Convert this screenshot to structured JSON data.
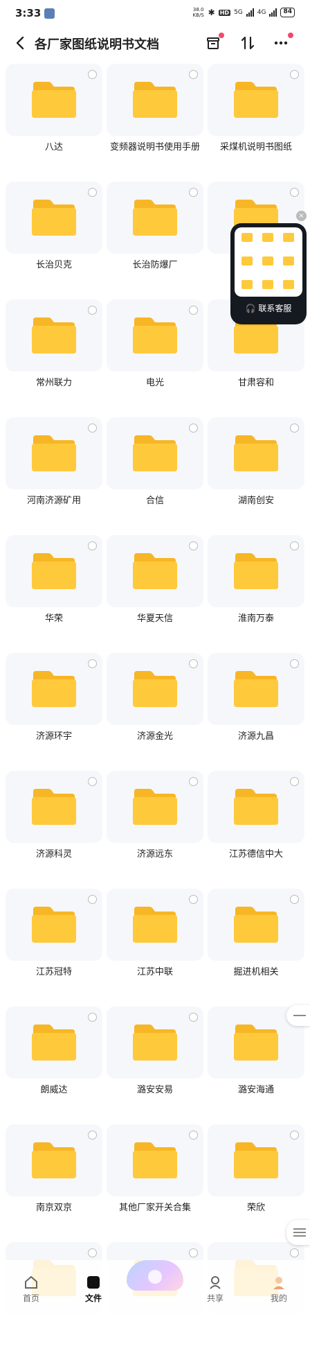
{
  "status_bar": {
    "time": "3:33",
    "net_speed_value": "38.0",
    "net_speed_unit": "KB/S",
    "hd": "HD",
    "network_5g": "5G",
    "network_4g": "4G",
    "battery": "84"
  },
  "header": {
    "title": "各厂家图纸说明书文档"
  },
  "folders": [
    {
      "label": "八达"
    },
    {
      "label": "变频器说明书使用手册"
    },
    {
      "label": "采煤机说明书图纸"
    },
    {
      "label": "长治贝克"
    },
    {
      "label": "长治防爆厂"
    },
    {
      "label": ""
    },
    {
      "label": "常州联力"
    },
    {
      "label": "电光"
    },
    {
      "label": "甘肃容和"
    },
    {
      "label": "河南济源矿用"
    },
    {
      "label": "合信"
    },
    {
      "label": "湖南创安"
    },
    {
      "label": "华荣"
    },
    {
      "label": "华夏天信"
    },
    {
      "label": "淮南万泰"
    },
    {
      "label": "济源环宇"
    },
    {
      "label": "济源金光"
    },
    {
      "label": "济源九昌"
    },
    {
      "label": "济源科灵"
    },
    {
      "label": "济源远东"
    },
    {
      "label": "江苏德信中大"
    },
    {
      "label": "江苏冠特"
    },
    {
      "label": "江苏中联"
    },
    {
      "label": "掘进机相关"
    },
    {
      "label": "朗威达"
    },
    {
      "label": "潞安安易"
    },
    {
      "label": "潞安海通"
    },
    {
      "label": "南京双京"
    },
    {
      "label": "其他厂家开关合集"
    },
    {
      "label": "荣欣"
    },
    {
      "label": ""
    },
    {
      "label": ""
    },
    {
      "label": ""
    }
  ],
  "floating_service": {
    "label": "联系客服"
  },
  "tabbar": {
    "items": [
      {
        "label": "首页"
      },
      {
        "label": "文件"
      },
      {
        "label": ""
      },
      {
        "label": "共享"
      },
      {
        "label": "我的"
      }
    ]
  },
  "colors": {
    "folder": "#ffc93c",
    "folder_back": "#f7b625",
    "card_bg": "#f6f7fa",
    "badge": "#f2496b"
  }
}
